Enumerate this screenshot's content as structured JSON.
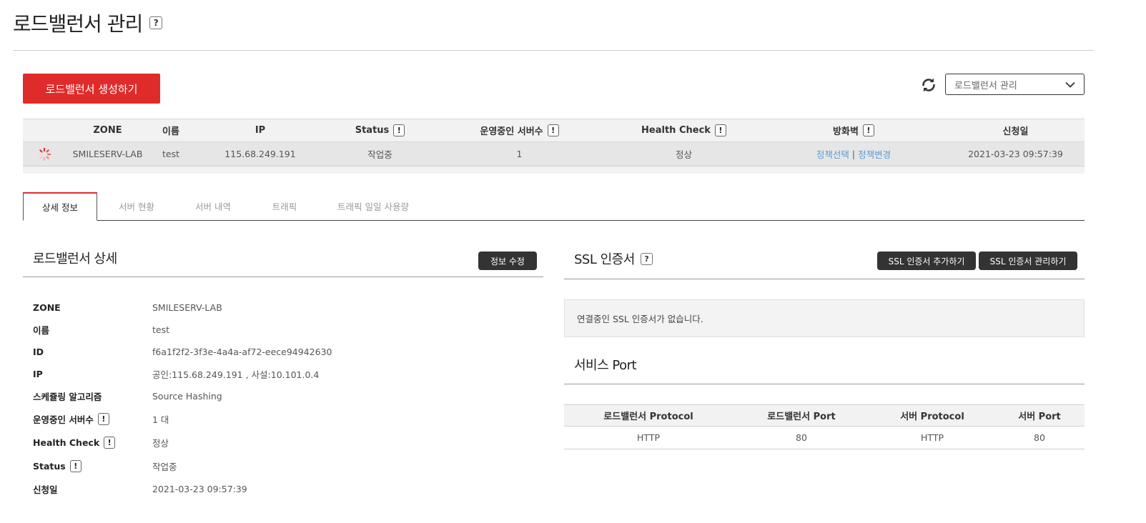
{
  "page": {
    "title": "로드밸런서 관리",
    "help": "?"
  },
  "toolbar": {
    "create_label": "로드밸런서 생성하기",
    "refresh_icon": "refresh-icon",
    "select_value": "로드밸런서 관리"
  },
  "lb_table": {
    "headers": [
      "",
      "ZONE",
      "이름",
      "IP",
      "Status",
      "운영중인 서버수",
      "Health Check",
      "방화벽",
      "신청일"
    ],
    "row": {
      "zone": "SMILESERV-LAB",
      "name": "test",
      "ip": "115.68.249.191",
      "status": "작업중",
      "servers": "1",
      "health": "정상",
      "fw_select": "정책선택",
      "fw_sep": "|",
      "fw_change": "정책변경",
      "date": "2021-03-23 09:57:39"
    },
    "warn": "!"
  },
  "tabs": [
    {
      "label": "상세 정보"
    },
    {
      "label": "서버 현황"
    },
    {
      "label": "서버 내역"
    },
    {
      "label": "트래픽"
    },
    {
      "label": "트래픽 일일 사용량"
    }
  ],
  "detail": {
    "title": "로드밸런서 상세",
    "edit_label": "정보 수정",
    "rows": [
      {
        "label": "ZONE",
        "value": "SMILESERV-LAB"
      },
      {
        "label": "이름",
        "value": "test"
      },
      {
        "label": "ID",
        "value": "f6a1f2f2-3f3e-4a4a-af72-eece94942630"
      },
      {
        "label": "IP",
        "value": "공인:115.68.249.191 , 사설:10.101.0.4"
      },
      {
        "label": "스케쥴링 알고리즘",
        "value": "Source Hashing"
      },
      {
        "label": "운영중인 서버수",
        "value": "1 대"
      },
      {
        "label": "Health Check",
        "value": "정상"
      },
      {
        "label": "Status",
        "value": "작업중"
      },
      {
        "label": "신청일",
        "value": "2021-03-23 09:57:39"
      }
    ]
  },
  "ssl": {
    "title": "SSL 인증서",
    "add_label": "SSL 인증서 추가하기",
    "manage_label": "SSL 인증서 관리하기",
    "empty": "연결중인 SSL 인증서가 없습니다."
  },
  "port": {
    "title": "서비스 Port",
    "headers": [
      "로드밸런서 Protocol",
      "로드밸런서 Port",
      "서버 Protocol",
      "서버 Port"
    ],
    "row": [
      "HTTP",
      "80",
      "HTTP",
      "80"
    ]
  },
  "colors": {
    "accent": "#e02b2b",
    "dark_button": "#333333",
    "link": "#5a9bd5"
  }
}
